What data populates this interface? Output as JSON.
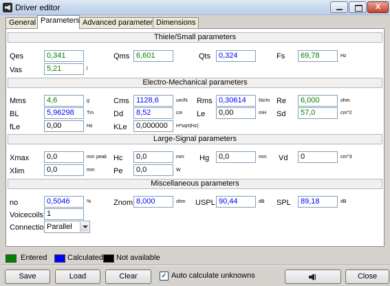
{
  "window": {
    "title": "Driver editor",
    "minimize_icon": "minimize-icon",
    "maximize_icon": "maximize-icon",
    "close_icon": "close-icon",
    "close_glyph": "X"
  },
  "tabs": [
    {
      "label": "General"
    },
    {
      "label": "Parameters"
    },
    {
      "label": "Advanced parameters"
    },
    {
      "label": "Dimensions"
    }
  ],
  "sections": {
    "ts": "Thiele/Small parameters",
    "em": "Electro-Mechanical parameters",
    "ls": "Large-Signal parameters",
    "misc": "Miscellaneous parameters"
  },
  "params": {
    "qes": {
      "label": "Qes",
      "value": "0,341",
      "unit": "",
      "status": "entered"
    },
    "qms": {
      "label": "Qms",
      "value": "6,601",
      "unit": "",
      "status": "entered"
    },
    "qts": {
      "label": "Qts",
      "value": "0,324",
      "unit": "",
      "status": "calculated"
    },
    "fs": {
      "label": "Fs",
      "value": "69,78",
      "unit": "Hz",
      "status": "entered"
    },
    "vas": {
      "label": "Vas",
      "value": "5,21",
      "unit": "l",
      "status": "entered"
    },
    "mms": {
      "label": "Mms",
      "value": "4,6",
      "unit": "g",
      "status": "entered"
    },
    "cms": {
      "label": "Cms",
      "value": "1128,6",
      "unit": "um/N",
      "status": "calculated"
    },
    "rms": {
      "label": "Rms",
      "value": "0,30614",
      "unit": "Ns/m",
      "status": "calculated"
    },
    "re": {
      "label": "Re",
      "value": "6,000",
      "unit": "ohm",
      "status": "entered"
    },
    "bl": {
      "label": "BL",
      "value": "5,96298",
      "unit": "Tm",
      "status": "calculated"
    },
    "dd": {
      "label": "Dd",
      "value": "8,52",
      "unit": "cm",
      "status": "calculated"
    },
    "le": {
      "label": "Le",
      "value": "0,00",
      "unit": "mH",
      "status": "na"
    },
    "sd": {
      "label": "Sd",
      "value": "57,0",
      "unit": "cm^2",
      "status": "entered"
    },
    "fle": {
      "label": "fLe",
      "value": "0,00",
      "unit": "Hz",
      "status": "na"
    },
    "kle": {
      "label": "KLe",
      "value": "0,000000",
      "unit": "H*sqrt(Hz)",
      "status": "na"
    },
    "xmax": {
      "label": "Xmax",
      "value": "0,0",
      "unit": "mm",
      "extra": "peak",
      "status": "na"
    },
    "hc": {
      "label": "Hc",
      "value": "0,0",
      "unit": "mm",
      "status": "na"
    },
    "hg": {
      "label": "Hg",
      "value": "0,0",
      "unit": "mm",
      "status": "na"
    },
    "vd": {
      "label": "Vd",
      "value": "0",
      "unit": "cm^3",
      "status": "na"
    },
    "xlim": {
      "label": "Xlim",
      "value": "0,0",
      "unit": "mm",
      "status": "na"
    },
    "pe": {
      "label": "Pe",
      "value": "0,0",
      "unit": "W",
      "status": "na"
    },
    "no": {
      "label": "no",
      "value": "0,5046",
      "unit": "%",
      "status": "calculated"
    },
    "znom": {
      "label": "Znom",
      "value": "8,000",
      "unit": "ohm",
      "status": "calculated"
    },
    "uspl": {
      "label": "USPL",
      "value": "90,44",
      "unit": "dB",
      "status": "calculated"
    },
    "spl": {
      "label": "SPL",
      "value": "89,18",
      "unit": "dB",
      "status": "calculated"
    },
    "voicecoils": {
      "label": "Voicecoils",
      "value": "1",
      "status": "na"
    }
  },
  "connection": {
    "label": "Connection",
    "value": "Parallel"
  },
  "legend": {
    "entered": {
      "label": "Entered",
      "color": "#008000"
    },
    "calculated": {
      "label": "Calculated",
      "color": "#0000ff"
    },
    "na": {
      "label": "Not available",
      "color": "#000000"
    }
  },
  "buttons": {
    "save": "Save",
    "load": "Load",
    "clear": "Clear",
    "auto_calc": "Auto calculate unknowns",
    "auto_calc_checked": true,
    "close": "Close"
  },
  "icons": {
    "app": "speaker-icon",
    "sound": "speaker-icon",
    "dropdown": "chevron-down-icon"
  }
}
